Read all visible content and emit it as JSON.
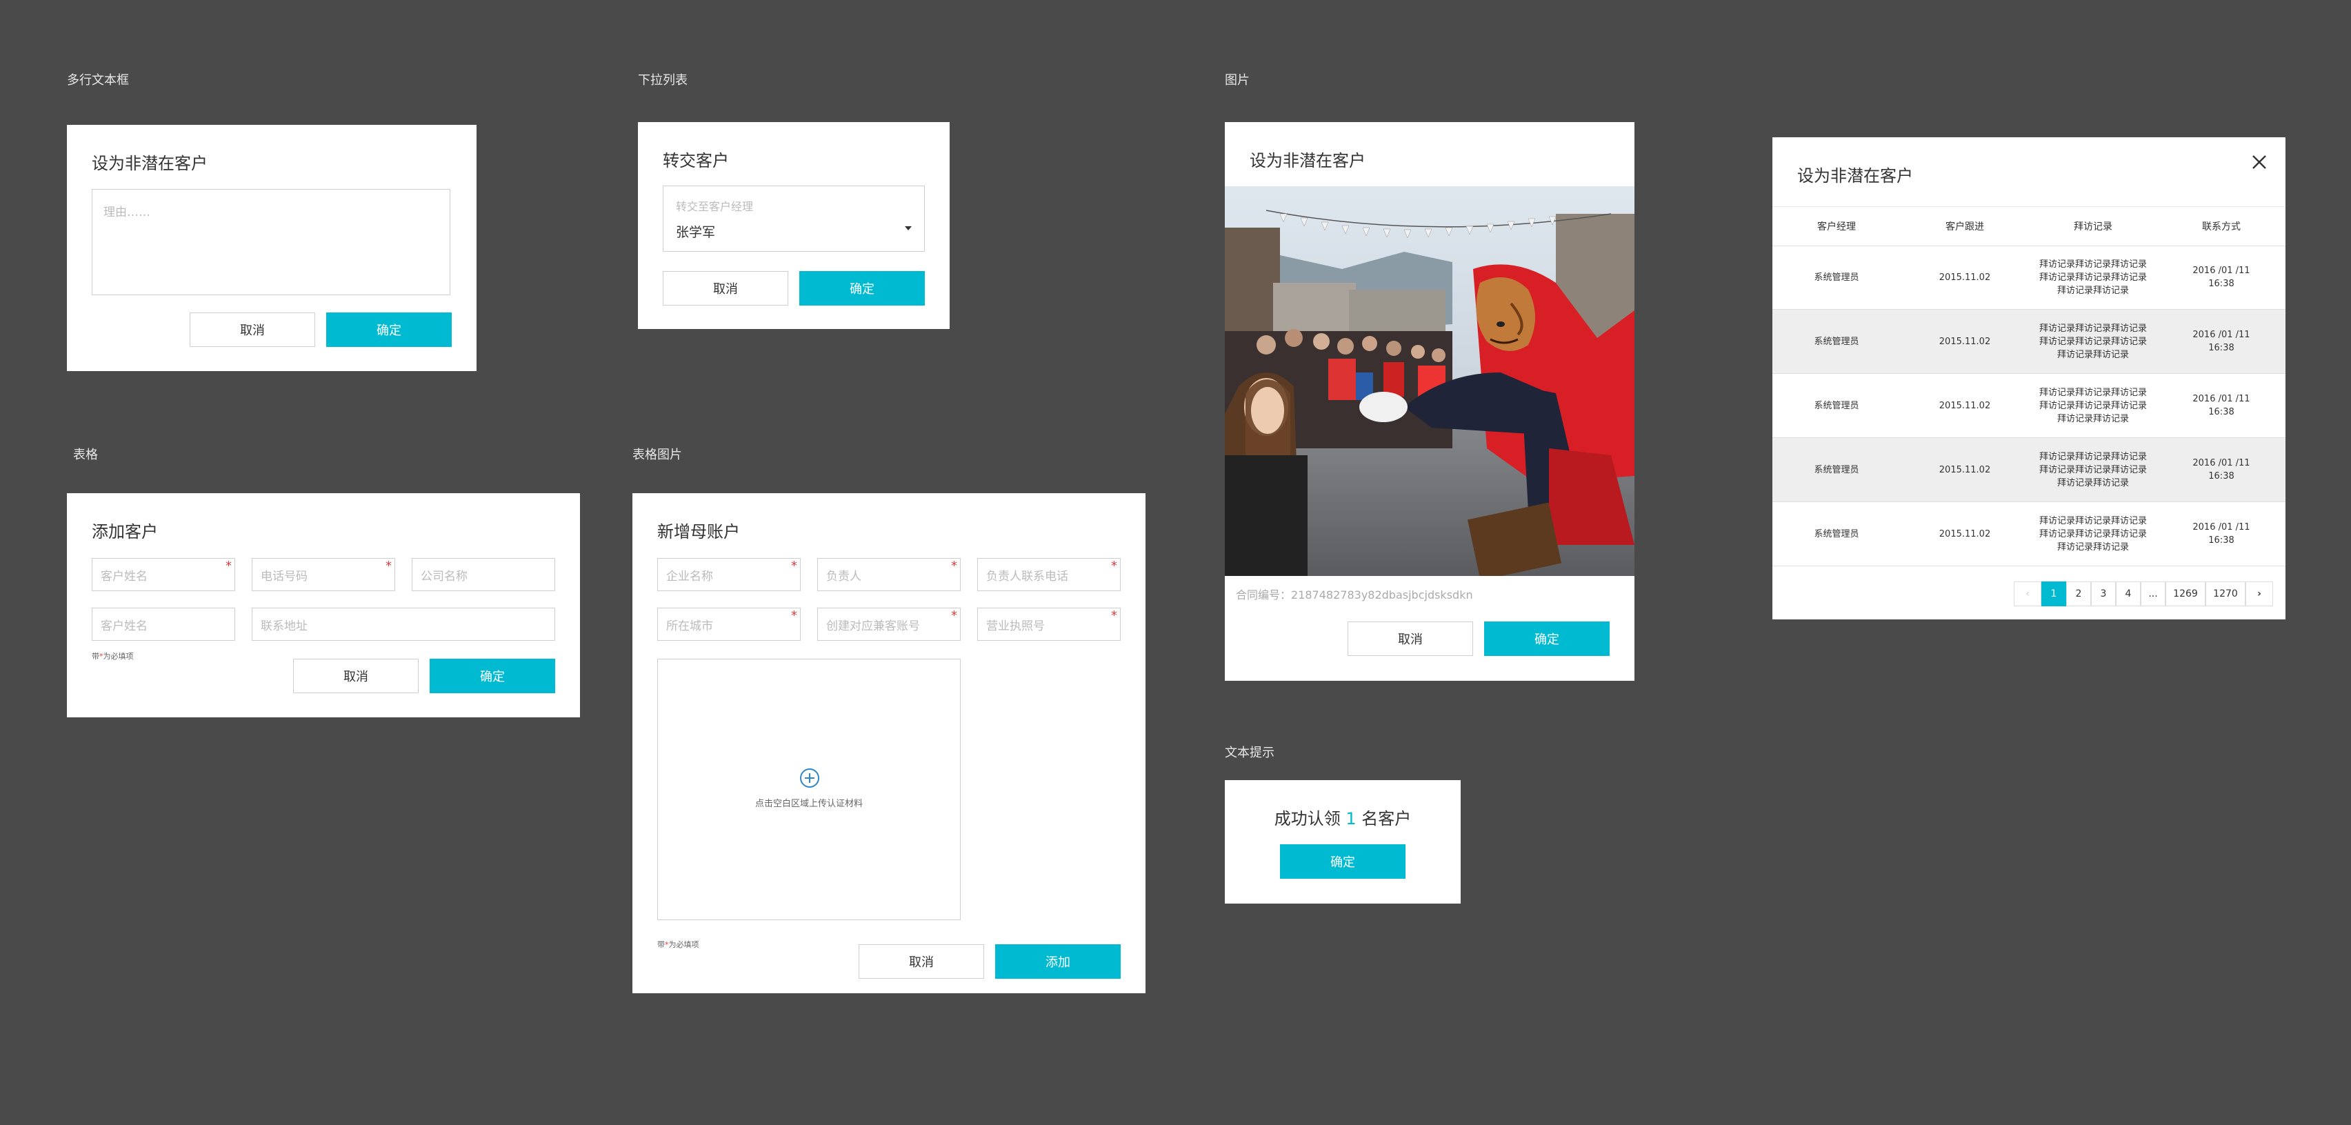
{
  "labels": {
    "textarea": "多行文本框",
    "dropdown": "下拉列表",
    "image": "图片",
    "table": "表格",
    "table_image": "表格图片",
    "text_tip": "文本提示"
  },
  "buttons": {
    "cancel": "取消",
    "confirm": "确定",
    "add": "添加"
  },
  "card_textarea": {
    "title": "设为非潜在客户",
    "placeholder": "理由……"
  },
  "card_dropdown": {
    "title": "转交客户",
    "select_label": "转交至客户经理",
    "select_value": "张学军"
  },
  "card_image": {
    "title": "设为非潜在客户",
    "contract_label": "合同编号：",
    "contract_value": "2187482783y82dbasjbcjdsksdkn"
  },
  "card_table_list": {
    "title": "设为非潜在客户",
    "columns": [
      "客户经理",
      "客户跟进",
      "拜访记录",
      "联系方式"
    ],
    "rows": [
      {
        "manager": "系统管理员",
        "followup": "2015.11.02",
        "visit": [
          "拜访记录拜访记录拜访记录",
          "拜访记录拜访记录拜访记录",
          "拜访记录拜访记录"
        ],
        "contact": [
          "2016 /01 /11",
          "16:38"
        ]
      },
      {
        "manager": "系统管理员",
        "followup": "2015.11.02",
        "visit": [
          "拜访记录拜访记录拜访记录",
          "拜访记录拜访记录拜访记录",
          "拜访记录拜访记录"
        ],
        "contact": [
          "2016 /01 /11",
          "16:38"
        ]
      },
      {
        "manager": "系统管理员",
        "followup": "2015.11.02",
        "visit": [
          "拜访记录拜访记录拜访记录",
          "拜访记录拜访记录拜访记录",
          "拜访记录拜访记录"
        ],
        "contact": [
          "2016 /01 /11",
          "16:38"
        ]
      },
      {
        "manager": "系统管理员",
        "followup": "2015.11.02",
        "visit": [
          "拜访记录拜访记录拜访记录",
          "拜访记录拜访记录拜访记录",
          "拜访记录拜访记录"
        ],
        "contact": [
          "2016 /01 /11",
          "16:38"
        ]
      },
      {
        "manager": "系统管理员",
        "followup": "2015.11.02",
        "visit": [
          "拜访记录拜访记录拜访记录",
          "拜访记录拜访记录拜访记录",
          "拜访记录拜访记录"
        ],
        "contact": [
          "2016 /01 /11",
          "16:38"
        ]
      }
    ],
    "pagination": {
      "prev": "‹",
      "pages": [
        "1",
        "2",
        "3",
        "4",
        "...",
        "1269",
        "1270"
      ],
      "current": "1",
      "next": "›"
    }
  },
  "card_add_customer": {
    "title": "添加客户",
    "fields": {
      "name1": "客户姓名",
      "phone": "电话号码",
      "company": "公司名称",
      "name2": "客户姓名",
      "address": "联系地址"
    },
    "required_note": "带*为必填项"
  },
  "card_new_account": {
    "title": "新增母账户",
    "fields": {
      "company": "企业名称",
      "owner": "负责人",
      "owner_phone": "负责人联系电话",
      "city": "所在城市",
      "cs_account": "创建对应兼客账号",
      "license": "营业执照号"
    },
    "upload_text": "点击空白区域上传认证材料",
    "required_note": "带*为必填项"
  },
  "card_tip": {
    "prefix": "成功认领",
    "count": "1",
    "suffix": "名客户"
  },
  "colors": {
    "background": "#4a4a4a",
    "accent": "#00bad2",
    "required": "#e03c3c"
  }
}
